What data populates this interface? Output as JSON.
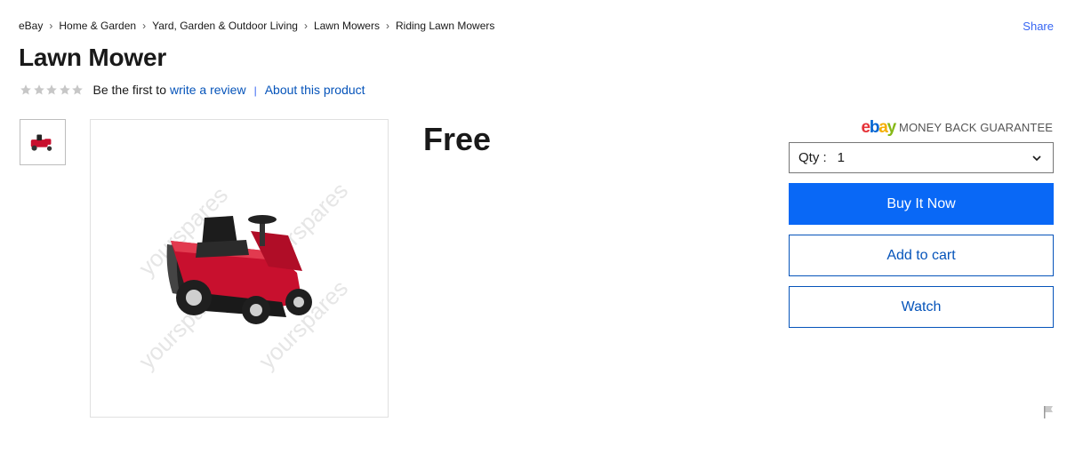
{
  "breadcrumb": [
    "eBay",
    "Home & Garden",
    "Yard, Garden & Outdoor Living",
    "Lawn Mowers",
    "Riding Lawn Mowers"
  ],
  "share_label": "Share",
  "title": "Lawn Mower",
  "rating": {
    "stars_filled": 0,
    "stars_total": 5,
    "prefix": "Be the first to",
    "write_review": "write a review",
    "separator": "|",
    "about": "About this product"
  },
  "image": {
    "watermark": "yourspares",
    "subject": "red riding lawn mower"
  },
  "price": "Free",
  "guarantee": {
    "logo": "ebay",
    "text": "MONEY BACK GUARANTEE"
  },
  "quantity": {
    "label": "Qty :",
    "value": "1"
  },
  "buttons": {
    "buy_now": "Buy It Now",
    "add_to_cart": "Add to cart",
    "watch": "Watch"
  },
  "colors": {
    "primary": "#0968f6",
    "link": "#0654ba",
    "text": "#191919",
    "mower_red": "#c8102e"
  },
  "icons": {
    "breadcrumb_sep": "chevron-right-icon",
    "qty": "chevron-down-icon",
    "report": "flag-icon",
    "rating": "star-icon"
  }
}
